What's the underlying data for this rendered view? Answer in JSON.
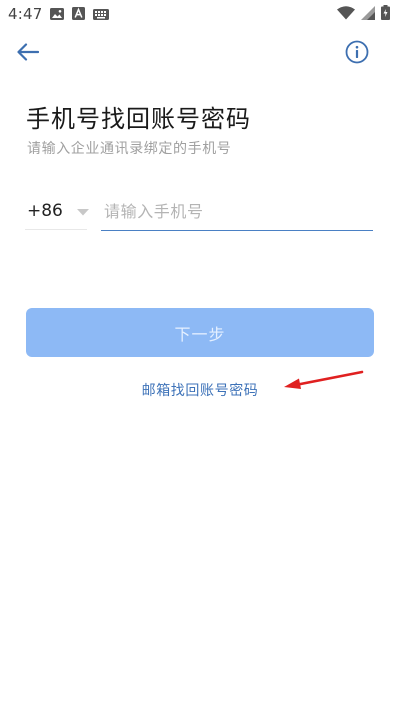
{
  "status_bar": {
    "time": "4:47",
    "icons": [
      "image-icon",
      "a-badge-icon",
      "keyboard-icon",
      "wifi-icon",
      "signal-icon",
      "battery-icon"
    ]
  },
  "header": {
    "back_icon": "arrow-left-icon",
    "info_icon": "info-circle-icon"
  },
  "main": {
    "title": "手机号找回账号密码",
    "subtitle": "请输入企业通讯录绑定的手机号",
    "country_code": "+86",
    "phone_input": {
      "value": "",
      "placeholder": "请输入手机号"
    },
    "next_label": "下一步",
    "email_link": "邮箱找回账号密码"
  },
  "colors": {
    "accent": "#4a80c4",
    "button_disabled": "#8db9f5",
    "link": "#3d72b8",
    "annotation": "#e02020"
  }
}
